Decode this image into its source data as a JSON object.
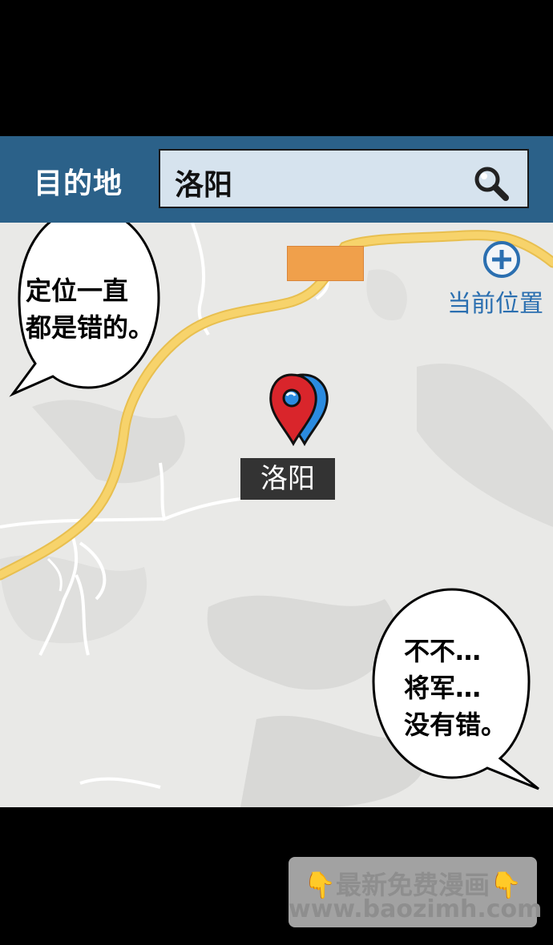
{
  "header": {
    "destination_label": "目的地",
    "search_value": "洛阳"
  },
  "map": {
    "current_location_label": "当前位置",
    "pin_label": "洛阳",
    "colors": {
      "road": "#f7d36b",
      "building": "#f0a04b",
      "pin_red": "#d9252b",
      "pin_blue": "#2b8be0"
    }
  },
  "bubbles": {
    "left_text": "定位一直\n都是错的。",
    "right_text": "不不…\n将军…\n没有错。"
  },
  "watermark": {
    "line1": "最新免费漫画",
    "line2": "www.baozimh.com",
    "icon": "pointing-down-hand-icon"
  }
}
